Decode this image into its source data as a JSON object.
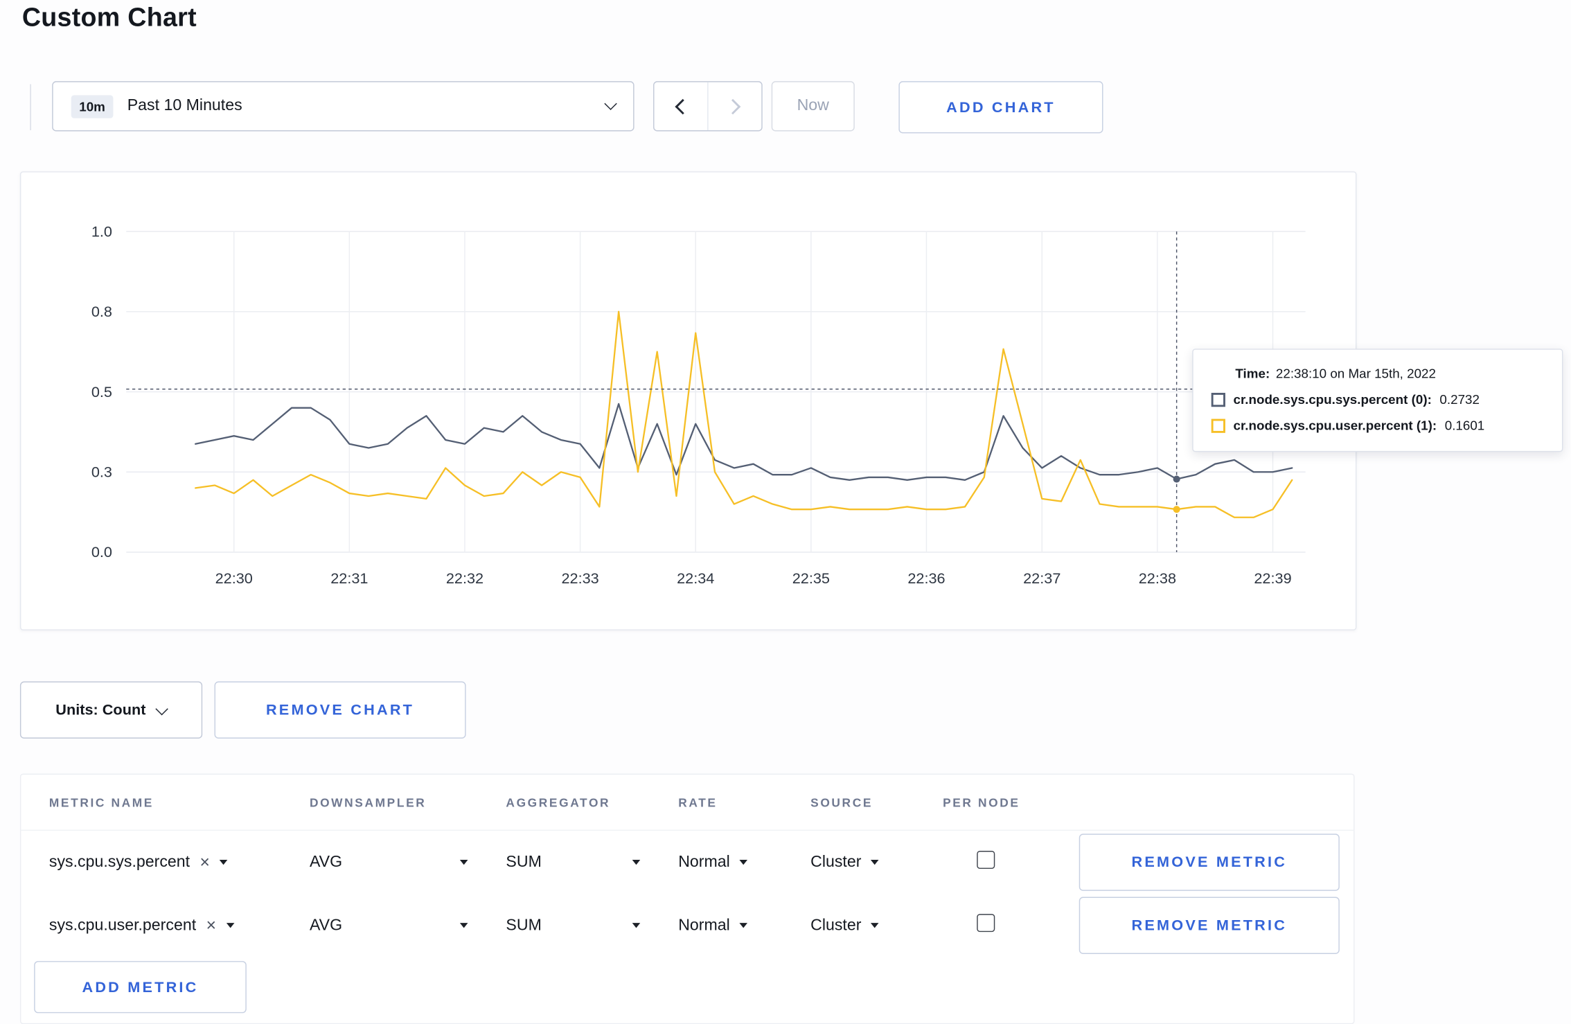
{
  "page": {
    "title": "Custom Chart"
  },
  "colors": {
    "accent": "#3464d8",
    "series_sys": "#545f74",
    "series_user": "#f6bf26"
  },
  "icons": {
    "clear": "×"
  },
  "toolbar": {
    "range_badge": "10m",
    "range_label": "Past 10 Minutes",
    "now_label": "Now",
    "add_chart_label": "ADD CHART"
  },
  "chart": {
    "crosshair": {
      "time": "22:38:10",
      "hover_value": 0.51,
      "points": [
        {
          "series": 0,
          "value": 0.2732
        },
        {
          "series": 1,
          "value": 0.1601
        }
      ]
    },
    "tooltip": {
      "time_label": "Time:",
      "time_value": "22:38:10 on Mar 15th, 2022",
      "rows": [
        {
          "name": "cr.node.sys.cpu.sys.percent (0):",
          "value": "0.2732"
        },
        {
          "name": "cr.node.sys.cpu.user.percent (1):",
          "value": "0.1601"
        }
      ]
    }
  },
  "chart_data": {
    "type": "line",
    "x_domain": {
      "start": "22:29:04",
      "end": "22:39:17"
    },
    "x_ticks": [
      "22:30",
      "22:31",
      "22:32",
      "22:33",
      "22:34",
      "22:35",
      "22:36",
      "22:37",
      "22:38",
      "22:39"
    ],
    "y_axis": {
      "ticks": [
        0,
        0.3,
        0.5,
        0.8,
        1.0
      ],
      "tick_labels": [
        "0.0",
        "0.3",
        "0.5",
        "0.8",
        "1.0"
      ],
      "ylim": [
        0,
        1.0
      ]
    },
    "series_start": "22:29:40",
    "interval_seconds": 10,
    "grid": true,
    "series": [
      {
        "name": "cr.node.sys.cpu.sys.percent",
        "color": "#545f74",
        "values": [
          0.37,
          0.38,
          0.39,
          0.38,
          0.42,
          0.46,
          0.46,
          0.43,
          0.37,
          0.36,
          0.37,
          0.41,
          0.44,
          0.38,
          0.37,
          0.41,
          0.4,
          0.44,
          0.4,
          0.38,
          0.37,
          0.31,
          0.47,
          0.31,
          0.42,
          0.29,
          0.42,
          0.33,
          0.31,
          0.32,
          0.29,
          0.29,
          0.31,
          0.28,
          0.27,
          0.28,
          0.28,
          0.27,
          0.28,
          0.28,
          0.27,
          0.3,
          0.44,
          0.36,
          0.31,
          0.34,
          0.31,
          0.29,
          0.29,
          0.3,
          0.31,
          0.2732,
          0.29,
          0.32,
          0.33,
          0.3,
          0.3,
          0.31
        ]
      },
      {
        "name": "cr.node.sys.cpu.user.percent",
        "color": "#f6bf26",
        "values": [
          0.24,
          0.25,
          0.22,
          0.27,
          0.21,
          0.25,
          0.29,
          0.26,
          0.22,
          0.21,
          0.22,
          0.21,
          0.2,
          0.31,
          0.25,
          0.21,
          0.22,
          0.3,
          0.25,
          0.3,
          0.28,
          0.17,
          0.8,
          0.3,
          0.65,
          0.21,
          0.72,
          0.3,
          0.18,
          0.21,
          0.18,
          0.16,
          0.16,
          0.17,
          0.16,
          0.16,
          0.16,
          0.17,
          0.16,
          0.16,
          0.17,
          0.28,
          0.66,
          0.42,
          0.2,
          0.19,
          0.33,
          0.18,
          0.17,
          0.17,
          0.17,
          0.1601,
          0.17,
          0.17,
          0.13,
          0.13,
          0.16,
          0.27
        ]
      }
    ]
  },
  "units": {
    "label": "Units: Count",
    "remove_chart_label": "REMOVE CHART"
  },
  "metrics_table": {
    "headers": [
      "METRIC NAME",
      "DOWNSAMPLER",
      "AGGREGATOR",
      "RATE",
      "SOURCE",
      "PER NODE"
    ],
    "rows": [
      {
        "metric": "sys.cpu.sys.percent",
        "downsampler": "AVG",
        "aggregator": "SUM",
        "rate": "Normal",
        "source": "Cluster",
        "per_node": false,
        "remove_label": "REMOVE METRIC"
      },
      {
        "metric": "sys.cpu.user.percent",
        "downsampler": "AVG",
        "aggregator": "SUM",
        "rate": "Normal",
        "source": "Cluster",
        "per_node": false,
        "remove_label": "REMOVE METRIC"
      }
    ],
    "add_metric_label": "ADD METRIC"
  }
}
